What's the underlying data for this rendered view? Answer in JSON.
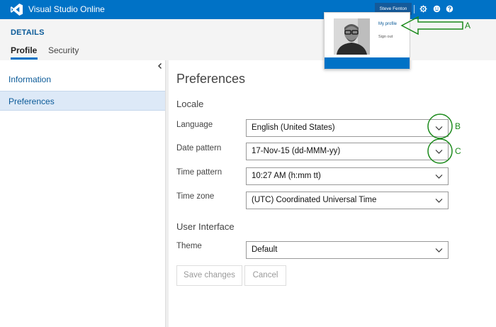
{
  "app": {
    "title": "Visual Studio Online"
  },
  "topbar": {
    "user_name": "Steve Fenton",
    "icons": [
      "gear-icon",
      "smiley-icon",
      "help-icon"
    ]
  },
  "header": {
    "section_title": "DETAILS",
    "tabs": [
      {
        "label": "Profile",
        "active": true
      },
      {
        "label": "Security",
        "active": false
      }
    ]
  },
  "sidebar": {
    "items": [
      {
        "label": "Information",
        "selected": false
      },
      {
        "label": "Preferences",
        "selected": true
      }
    ]
  },
  "main": {
    "title": "Preferences",
    "locale_heading": "Locale",
    "fields": {
      "language": {
        "label": "Language",
        "value": "English (United States)"
      },
      "date_pattern": {
        "label": "Date pattern",
        "value": "17-Nov-15 (dd-MMM-yy)"
      },
      "time_pattern": {
        "label": "Time pattern",
        "value": "10:27 AM (h:mm tt)"
      },
      "time_zone": {
        "label": "Time zone",
        "value": "(UTC) Coordinated Universal Time"
      }
    },
    "ui_heading": "User Interface",
    "theme": {
      "label": "Theme",
      "value": "Default"
    },
    "buttons": {
      "save": "Save changes",
      "cancel": "Cancel"
    }
  },
  "profile_popup": {
    "my_profile": "My profile",
    "sign_out": "Sign out"
  },
  "annotations": {
    "a": "A",
    "b": "B",
    "c": "C"
  },
  "colors": {
    "brand_blue": "#0072c6",
    "link_blue": "#0a5a98",
    "selected_bg": "#dde9f7",
    "annotation_green": "#1b8a1b"
  }
}
